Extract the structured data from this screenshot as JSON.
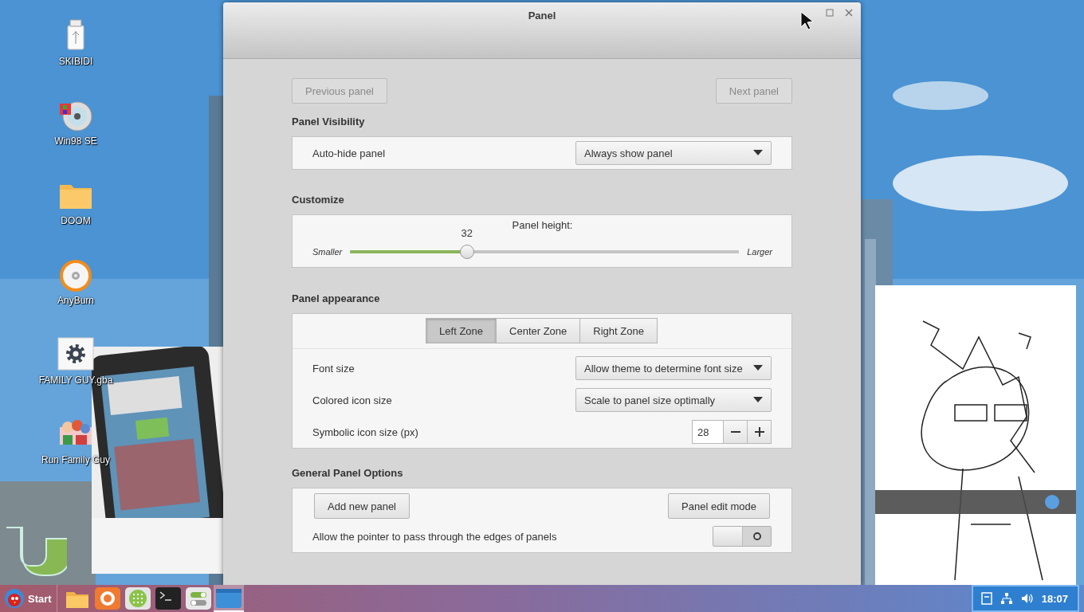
{
  "desktop_icons": [
    {
      "label": "SKIBIDI",
      "kind": "usb"
    },
    {
      "label": "Win98 SE",
      "kind": "disc"
    },
    {
      "label": "DOOM",
      "kind": "folder"
    },
    {
      "label": "AnyBurn",
      "kind": "burn"
    },
    {
      "label": "FAMILY GUY.gba",
      "kind": "gear"
    },
    {
      "label": "Run Family Guy",
      "kind": "cartoon"
    }
  ],
  "window": {
    "title": "Panel",
    "nav_buttons": [
      {
        "label": "Previous panel",
        "disabled": true
      },
      {
        "label": "Next panel",
        "disabled": true
      }
    ],
    "sections": [
      {
        "title": "Panel Visibility",
        "rows": [
          {
            "kind": "dropdown",
            "label": "Auto-hide panel",
            "value": "Always show panel"
          }
        ]
      },
      {
        "title": "Customize",
        "rows": [
          {
            "kind": "slider",
            "label": "Panel height:",
            "reading": "32",
            "min_label": "Smaller",
            "max_label": "Larger",
            "level": 0.3
          }
        ]
      },
      {
        "title": "Panel appearance",
        "rows": [
          {
            "kind": "tabs",
            "tabs": [
              {
                "label": "Left Zone",
                "selected": true
              },
              {
                "label": "Center Zone",
                "selected": false
              },
              {
                "label": "Right Zone",
                "selected": false
              }
            ]
          },
          {
            "kind": "dropdown",
            "label": "Font size",
            "value": "Allow theme to determine font size"
          },
          {
            "kind": "dropdown",
            "label": "Colored icon size",
            "value": "Scale to panel size optimally"
          },
          {
            "kind": "spin",
            "label": "Symbolic icon size (px)",
            "value": "28"
          }
        ]
      },
      {
        "title": "General Panel Options",
        "rows": [
          {
            "kind": "buttons",
            "buttons": [
              "Add new panel",
              "Panel edit mode"
            ]
          },
          {
            "kind": "switch",
            "label": "Allow the pointer to pass through the edges of panels",
            "on": false
          }
        ]
      }
    ]
  },
  "taskbar": {
    "start": "Start",
    "launchers": [
      {
        "kind": "files",
        "selected": false
      },
      {
        "kind": "browser",
        "selected": false
      },
      {
        "kind": "apps",
        "selected": false
      },
      {
        "kind": "terminal",
        "selected": false
      },
      {
        "kind": "switches",
        "selected": false
      },
      {
        "kind": "window",
        "selected": true
      }
    ],
    "clock": "18:07"
  }
}
